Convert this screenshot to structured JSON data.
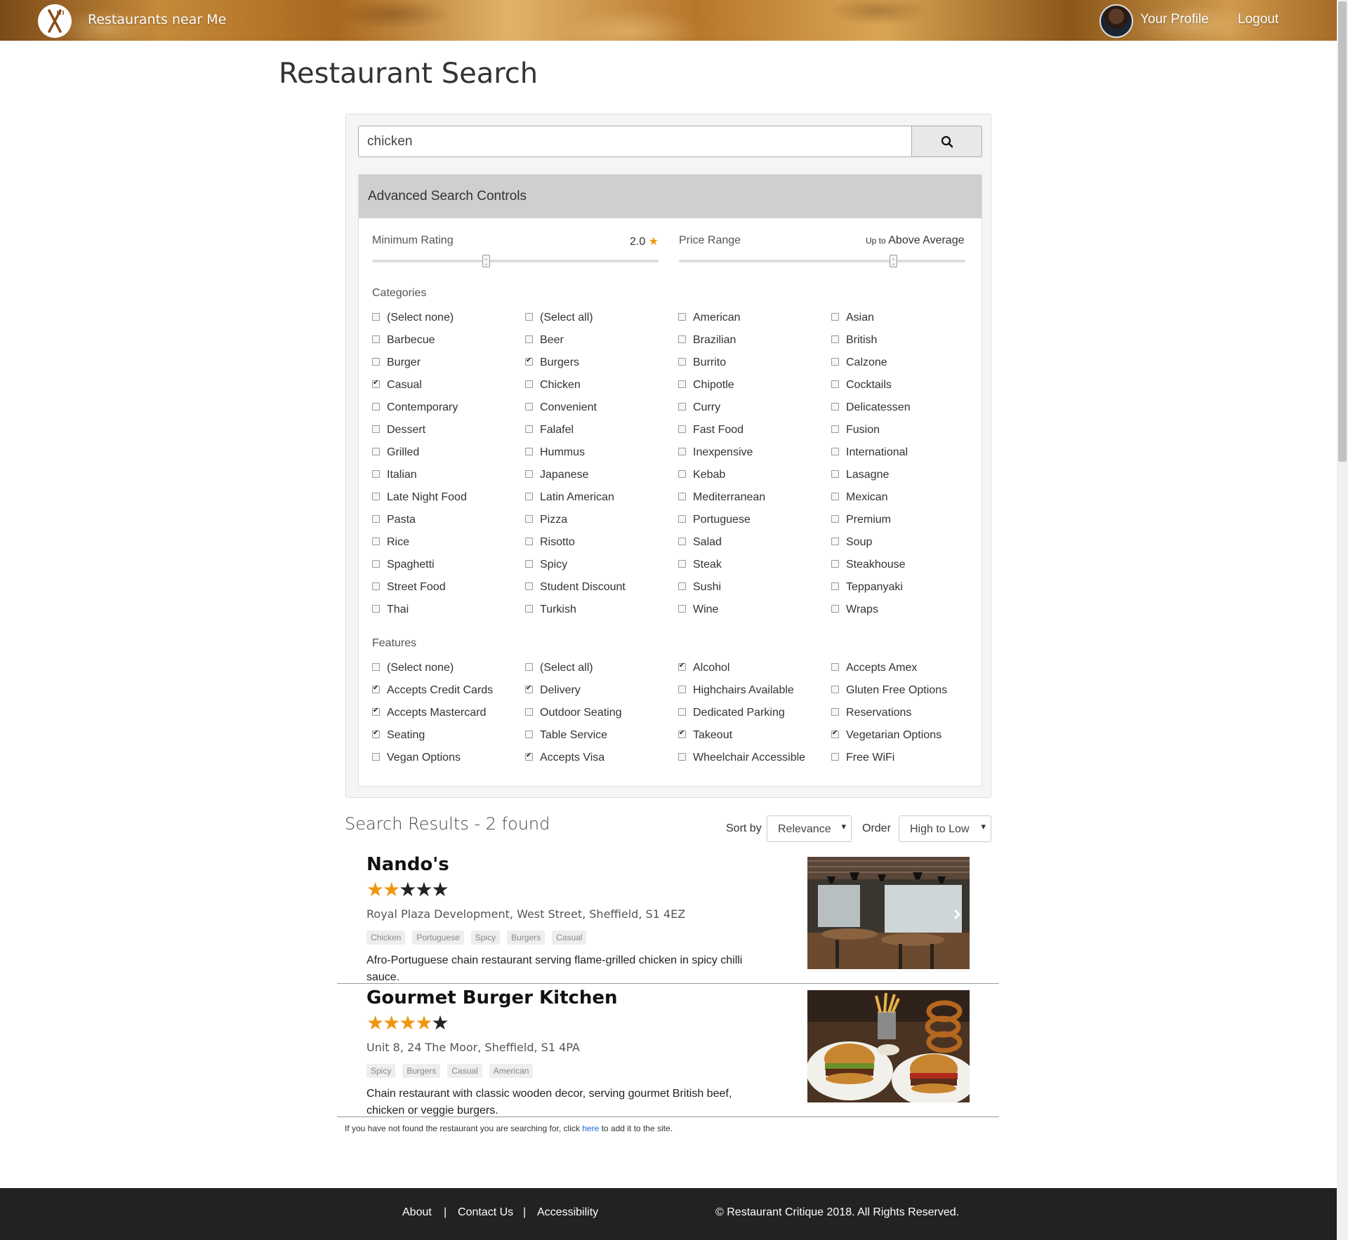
{
  "header": {
    "brand": "Restaurants near Me",
    "profile": "Your Profile",
    "logout": "Logout"
  },
  "page": {
    "title": "Restaurant Search"
  },
  "search": {
    "value": "chicken",
    "button_icon": "search-icon"
  },
  "advanced": {
    "title": "Advanced Search Controls",
    "min_rating": {
      "label": "Minimum Rating",
      "value": "2.0",
      "star": "★",
      "level": 0.4
    },
    "price": {
      "label": "Price Range",
      "prefix": "Up to",
      "value": "Above Average",
      "level": 0.75
    }
  },
  "categories": {
    "label": "Categories",
    "items": [
      {
        "label": "(Select none)",
        "checked": false
      },
      {
        "label": "(Select all)",
        "checked": false
      },
      {
        "label": "American",
        "checked": false
      },
      {
        "label": "Asian",
        "checked": false
      },
      {
        "label": "Barbecue",
        "checked": false
      },
      {
        "label": "Beer",
        "checked": false
      },
      {
        "label": "Brazilian",
        "checked": false
      },
      {
        "label": "British",
        "checked": false
      },
      {
        "label": "Burger",
        "checked": false
      },
      {
        "label": "Burgers",
        "checked": true
      },
      {
        "label": "Burrito",
        "checked": false
      },
      {
        "label": "Calzone",
        "checked": false
      },
      {
        "label": "Casual",
        "checked": true
      },
      {
        "label": "Chicken",
        "checked": false
      },
      {
        "label": "Chipotle",
        "checked": false
      },
      {
        "label": "Cocktails",
        "checked": false
      },
      {
        "label": "Contemporary",
        "checked": false
      },
      {
        "label": "Convenient",
        "checked": false
      },
      {
        "label": "Curry",
        "checked": false
      },
      {
        "label": "Delicatessen",
        "checked": false
      },
      {
        "label": "Dessert",
        "checked": false
      },
      {
        "label": "Falafel",
        "checked": false
      },
      {
        "label": "Fast Food",
        "checked": false
      },
      {
        "label": "Fusion",
        "checked": false
      },
      {
        "label": "Grilled",
        "checked": false
      },
      {
        "label": "Hummus",
        "checked": false
      },
      {
        "label": "Inexpensive",
        "checked": false
      },
      {
        "label": "International",
        "checked": false
      },
      {
        "label": "Italian",
        "checked": false
      },
      {
        "label": "Japanese",
        "checked": false
      },
      {
        "label": "Kebab",
        "checked": false
      },
      {
        "label": "Lasagne",
        "checked": false
      },
      {
        "label": "Late Night Food",
        "checked": false
      },
      {
        "label": "Latin American",
        "checked": false
      },
      {
        "label": "Mediterranean",
        "checked": false
      },
      {
        "label": "Mexican",
        "checked": false
      },
      {
        "label": "Pasta",
        "checked": false
      },
      {
        "label": "Pizza",
        "checked": false
      },
      {
        "label": "Portuguese",
        "checked": false
      },
      {
        "label": "Premium",
        "checked": false
      },
      {
        "label": "Rice",
        "checked": false
      },
      {
        "label": "Risotto",
        "checked": false
      },
      {
        "label": "Salad",
        "checked": false
      },
      {
        "label": "Soup",
        "checked": false
      },
      {
        "label": "Spaghetti",
        "checked": false
      },
      {
        "label": "Spicy",
        "checked": false
      },
      {
        "label": "Steak",
        "checked": false
      },
      {
        "label": "Steakhouse",
        "checked": false
      },
      {
        "label": "Street Food",
        "checked": false
      },
      {
        "label": "Student Discount",
        "checked": false
      },
      {
        "label": "Sushi",
        "checked": false
      },
      {
        "label": "Teppanyaki",
        "checked": false
      },
      {
        "label": "Thai",
        "checked": false
      },
      {
        "label": "Turkish",
        "checked": false
      },
      {
        "label": "Wine",
        "checked": false
      },
      {
        "label": "Wraps",
        "checked": false
      }
    ]
  },
  "features": {
    "label": "Features",
    "items": [
      {
        "label": "(Select none)",
        "checked": false
      },
      {
        "label": "(Select all)",
        "checked": false
      },
      {
        "label": "Alcohol",
        "checked": true
      },
      {
        "label": "Accepts Amex",
        "checked": false
      },
      {
        "label": "Accepts Credit Cards",
        "checked": true
      },
      {
        "label": "Delivery",
        "checked": true
      },
      {
        "label": "Highchairs Available",
        "checked": false
      },
      {
        "label": "Gluten Free Options",
        "checked": false
      },
      {
        "label": "Accepts Mastercard",
        "checked": true
      },
      {
        "label": "Outdoor Seating",
        "checked": false
      },
      {
        "label": "Dedicated Parking",
        "checked": false
      },
      {
        "label": "Reservations",
        "checked": false
      },
      {
        "label": "Seating",
        "checked": true
      },
      {
        "label": "Table Service",
        "checked": false
      },
      {
        "label": "Takeout",
        "checked": true
      },
      {
        "label": "Vegetarian Options",
        "checked": true
      },
      {
        "label": "Vegan Options",
        "checked": false
      },
      {
        "label": "Accepts Visa",
        "checked": true
      },
      {
        "label": "Wheelchair Accessible",
        "checked": false
      },
      {
        "label": "Free WiFi",
        "checked": false
      }
    ]
  },
  "results": {
    "title": "Search Results - 2 found",
    "sort_label": "Sort by",
    "sort_value": "Relevance",
    "order_label": "Order",
    "order_value": "High to Low",
    "items": [
      {
        "name": "Nando's",
        "rating": 2,
        "address": "Royal Plaza Development, West Street, Sheffield, S1 4EZ",
        "tags": [
          "Chicken",
          "Portuguese",
          "Spicy",
          "Burgers",
          "Casual"
        ],
        "description": "Afro-Portuguese chain restaurant serving flame-grilled chicken in spicy chilli sauce.",
        "photo_icon": "restaurant-interior-photo"
      },
      {
        "name": "Gourmet Burger Kitchen",
        "rating": 4,
        "address": "Unit 8, 24 The Moor, Sheffield, S1 4PA",
        "tags": [
          "Spicy",
          "Burgers",
          "Casual",
          "American"
        ],
        "description": "Chain restaurant with classic wooden decor, serving gourmet British beef, chicken or veggie burgers.",
        "photo_icon": "burgers-photo"
      }
    ],
    "footnote_before": "If you have not found the restaurant you are searching for, click ",
    "footnote_link": "here",
    "footnote_after": " to add it to the site."
  },
  "footer": {
    "about": "About",
    "contact": "Contact Us",
    "accessibility": "Accessibility",
    "separator": "|",
    "copyright": "© Restaurant Critique 2018. All Rights Reserved."
  },
  "colors": {
    "accent_star": "#f0960e",
    "footer_bg": "#222222",
    "link": "#1a6fd1"
  }
}
